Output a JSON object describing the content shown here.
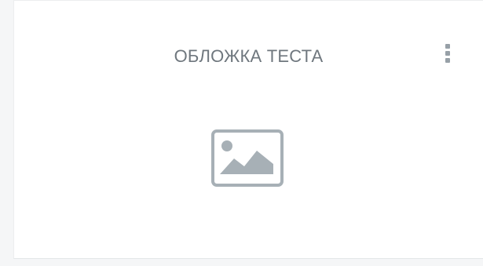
{
  "card": {
    "title": "ОБЛОЖКА ТЕСТА",
    "menu_icon": "kebab-vertical-icon",
    "image_icon": "image-placeholder-icon"
  },
  "colors": {
    "background": "#f5f6f7",
    "card": "#ffffff",
    "title_text": "#6f777e",
    "icon": "#a7b0b6"
  }
}
